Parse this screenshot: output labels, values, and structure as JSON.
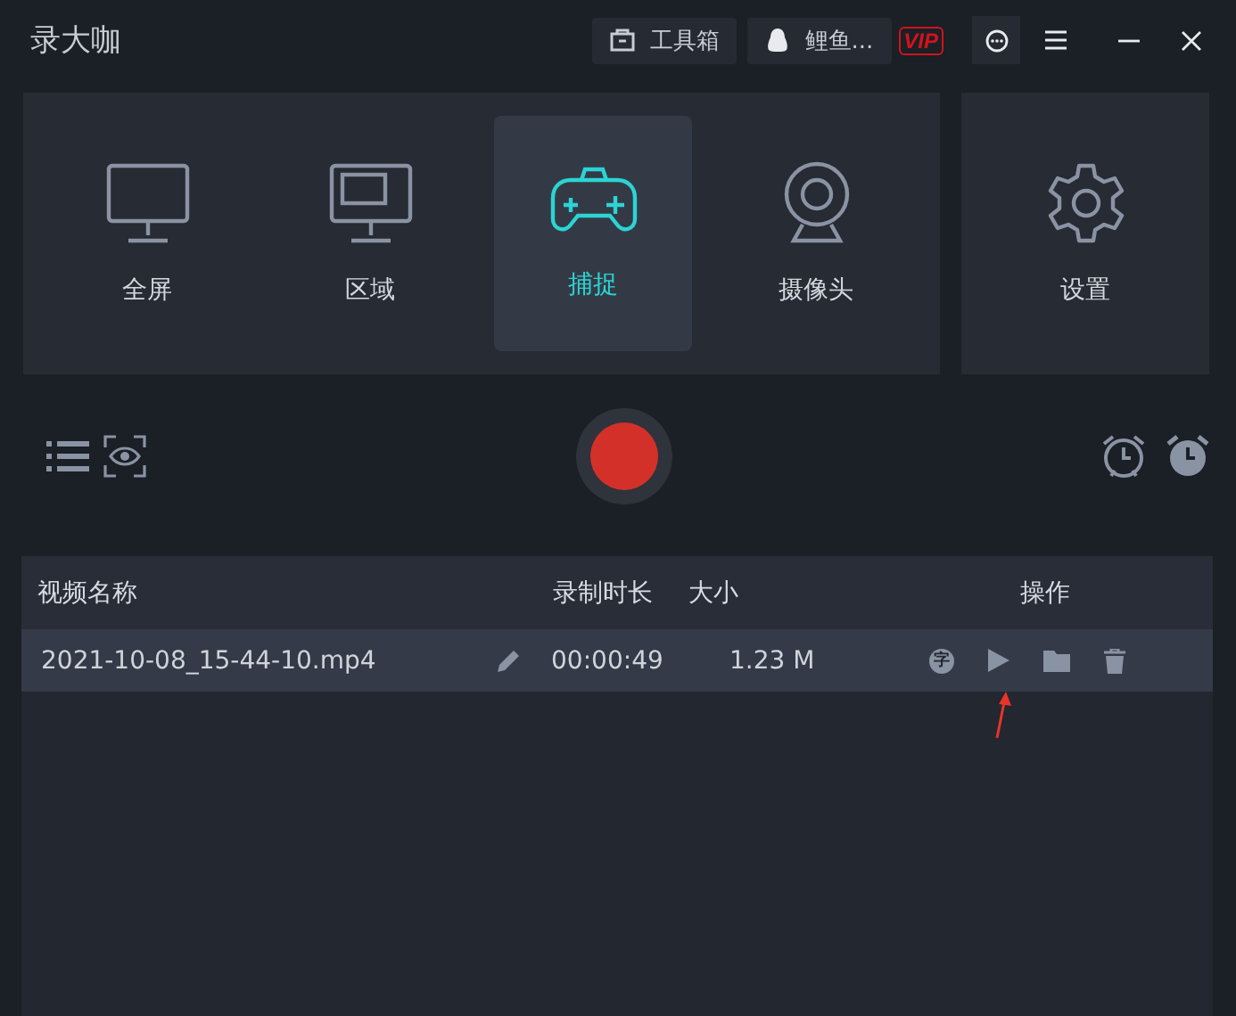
{
  "window": {
    "title": "录大咖"
  },
  "titlebar": {
    "toolbox": "工具箱",
    "user": "鲤鱼...",
    "vip": "VIP"
  },
  "modes": [
    {
      "kind": "screen",
      "label": "全屏",
      "selected": false
    },
    {
      "kind": "region",
      "label": "区域",
      "selected": false
    },
    {
      "kind": "capture",
      "label": "捕捉",
      "selected": true
    },
    {
      "kind": "camera",
      "label": "摄像头",
      "selected": false
    }
  ],
  "settings": {
    "label": "设置"
  },
  "table": {
    "columns": [
      "视频名称",
      "录制时长",
      "大小",
      "操作"
    ],
    "rows": [
      {
        "name": "2021-10-08_15-44-10.mp4",
        "duration": "00:00:49",
        "size": "1.23 M",
        "subtitle_glyph": "字",
        "selected": true
      }
    ]
  }
}
